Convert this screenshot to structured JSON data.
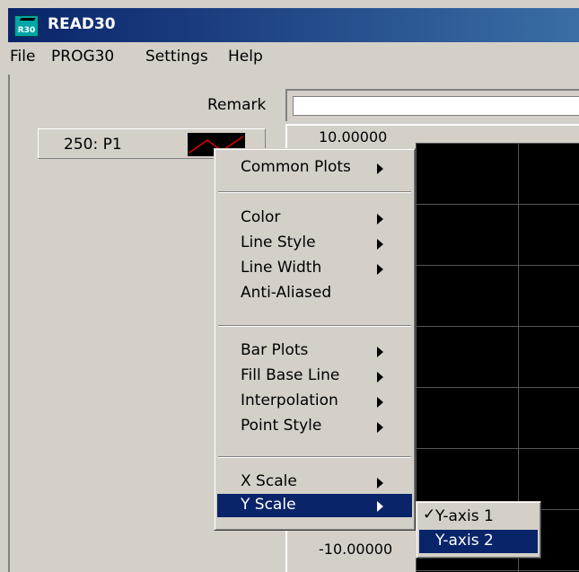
{
  "window": {
    "title": "READ30",
    "icon_text": "R30",
    "icon": "r30-app-icon"
  },
  "menubar": {
    "items": [
      "File",
      "PROG30",
      "Settings",
      "Help"
    ]
  },
  "remark": {
    "label": "Remark",
    "value": ""
  },
  "legend": {
    "label": "250: P1"
  },
  "plot": {
    "y_max_label": "10.00000",
    "y_min_label": "-10.00000"
  },
  "context_menu": {
    "items": [
      {
        "label": "Common Plots",
        "submenu": true
      },
      {
        "label": "Color",
        "submenu": true
      },
      {
        "label": "Line Style",
        "submenu": true
      },
      {
        "label": "Line Width",
        "submenu": true
      },
      {
        "label": "Anti-Aliased",
        "submenu": false
      },
      {
        "label": "Bar Plots",
        "submenu": true
      },
      {
        "label": "Fill Base Line",
        "submenu": true
      },
      {
        "label": "Interpolation",
        "submenu": true
      },
      {
        "label": "Point Style",
        "submenu": true
      },
      {
        "label": "X Scale",
        "submenu": true
      },
      {
        "label": "Y Scale",
        "submenu": true,
        "highlighted": true
      }
    ]
  },
  "y_scale_submenu": {
    "items": [
      {
        "label": "Y-axis 1",
        "checked": true,
        "check": "✓"
      },
      {
        "label": "Y-axis 2",
        "checked": false,
        "highlighted": true
      }
    ]
  },
  "colors": {
    "title_start": "#0a246a",
    "title_end": "#3a6ea5",
    "highlight": "#0a246a",
    "face": "#d4d0c8"
  }
}
